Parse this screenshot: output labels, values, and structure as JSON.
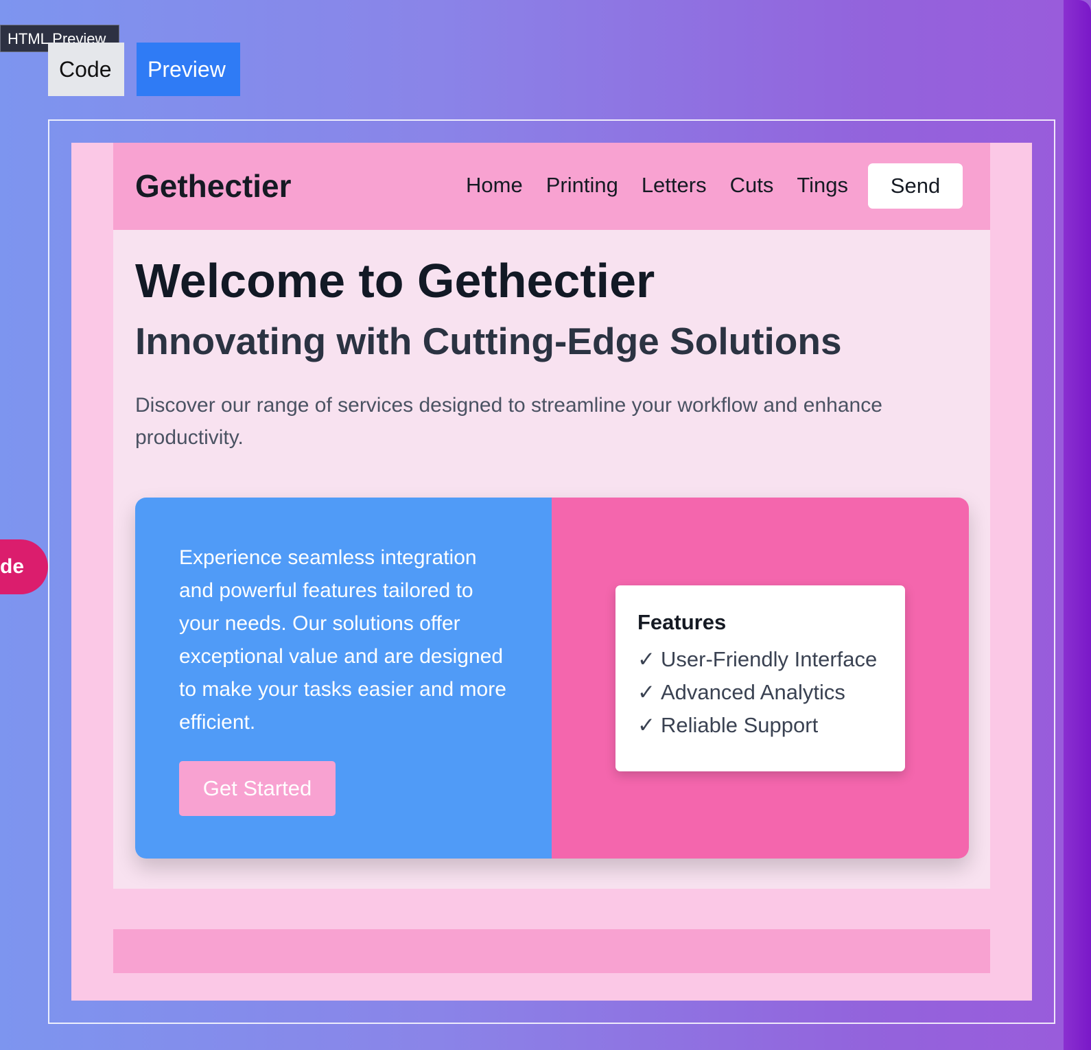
{
  "tooltip": "HTML Preview",
  "tabs": {
    "code": "Code",
    "preview": "Preview"
  },
  "side_pill": "de",
  "site": {
    "logo": "Gethectier",
    "nav": [
      "Home",
      "Printing",
      "Letters",
      "Cuts",
      "Tings"
    ],
    "send_label": "Send"
  },
  "hero": {
    "title": "Welcome to Gethectier",
    "subtitle": "Innovating with Cutting-Edge Solutions",
    "description": "Discover our range of services designed to streamline your workflow and enhance productivity."
  },
  "card": {
    "text": "Experience seamless integration and powerful features tailored to your needs. Our solutions offer exceptional value and are designed to make your tasks easier and more efficient.",
    "cta_label": "Get Started",
    "features_title": "Features",
    "check_glyph": "✓",
    "features": [
      "User-Friendly Interface",
      "Advanced Analytics",
      "Reliable Support"
    ]
  },
  "colors": {
    "active_tab": "#2f7bf5",
    "header_pink": "#f8a2d1",
    "card_blue": "#509bf7",
    "card_pink": "#f466ad",
    "side_pill": "#db1d6d"
  }
}
